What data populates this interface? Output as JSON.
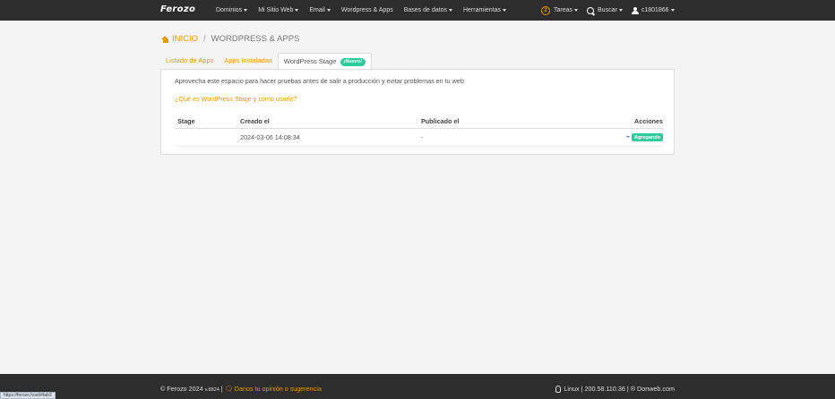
{
  "header": {
    "logo": "Ferozo",
    "nav": [
      "Dominios",
      "Mi Sitio Web",
      "Email",
      "Wordpress & Apps",
      "Bases de datos",
      "Herramientas"
    ],
    "tareas_count": "2",
    "tareas_label": "Tareas",
    "search_label": "Buscar",
    "user_label": "c1801866"
  },
  "breadcrumb": {
    "home": "INICIO",
    "separator": "/",
    "current": "WORDPRESS & APPS"
  },
  "tabs": [
    {
      "label": "Listado de Apps"
    },
    {
      "label": "Apps Instaladas"
    },
    {
      "label": "WordPress Stage",
      "badge": "¡Nuevo!"
    }
  ],
  "panel": {
    "intro": "Aprovecha este espacio para hacer pruebas antes de salir a producción y evitar problemas en tu web",
    "help_link": "¿Qué es WordPress Stage y cómo usarlo?",
    "table": {
      "headers": [
        "Stage",
        "Creado el",
        "Publicado el",
        "Acciones"
      ],
      "rows": [
        {
          "stage": "",
          "created": "2024-03-06 14:08:34",
          "published": "-",
          "status": "Agregando"
        }
      ]
    }
  },
  "footer": {
    "copyright": "© Ferozo 2024",
    "version": "v.8824",
    "sep": "|",
    "feedback": "Danos tu opinión o sugerencia",
    "server": "Linux | 200.58.110.36 | ® Donweb.com"
  },
  "status_url": "https://ferozo.host/#tab3"
}
